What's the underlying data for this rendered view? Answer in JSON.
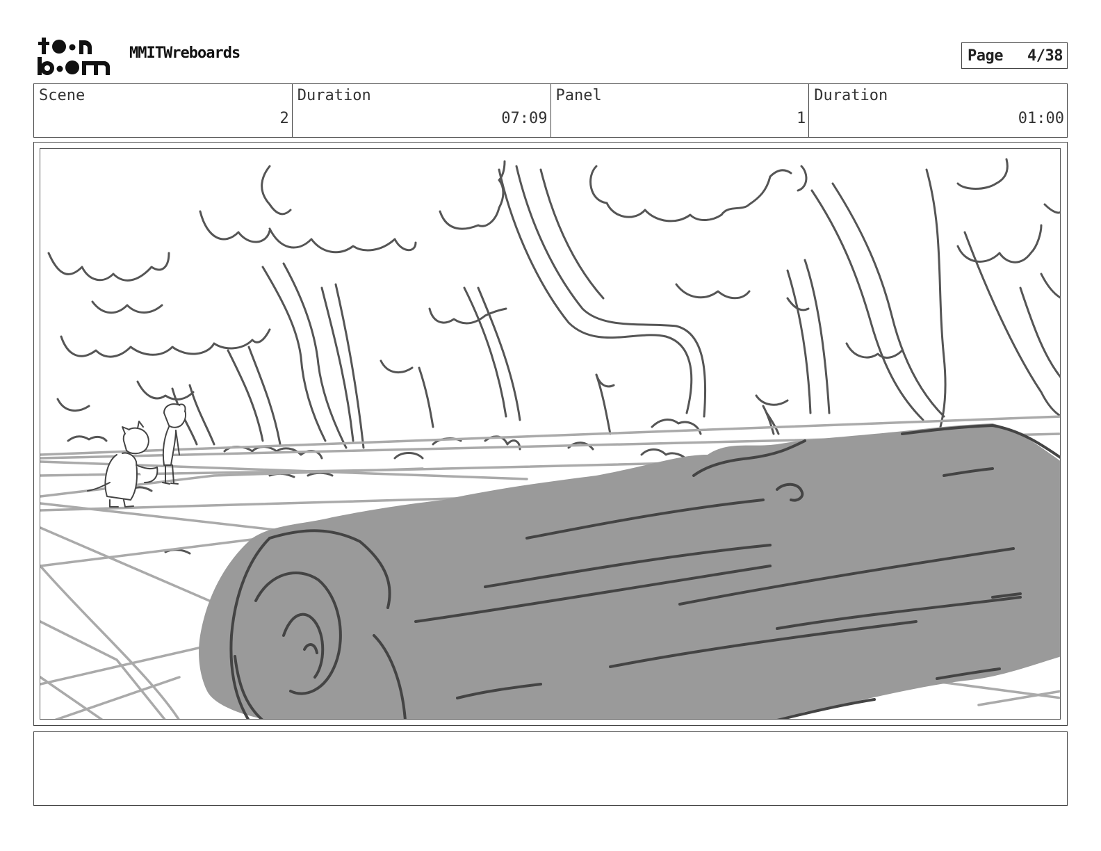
{
  "header": {
    "logo_alt": "toon boom",
    "project_title": "MMITWreboards",
    "page_label": "Page",
    "page_number": "4/38"
  },
  "info": {
    "scene_label": "Scene",
    "scene_value": "2",
    "scene_duration_label": "Duration",
    "scene_duration_value": "07:09",
    "panel_label": "Panel",
    "panel_value": "1",
    "panel_duration_label": "Duration",
    "panel_duration_value": "01:00"
  },
  "panel": {
    "drawing": "storyboard-sketch",
    "log_fill": "#9a9a9a",
    "line_color": "#555555"
  },
  "notes": {
    "text": ""
  }
}
